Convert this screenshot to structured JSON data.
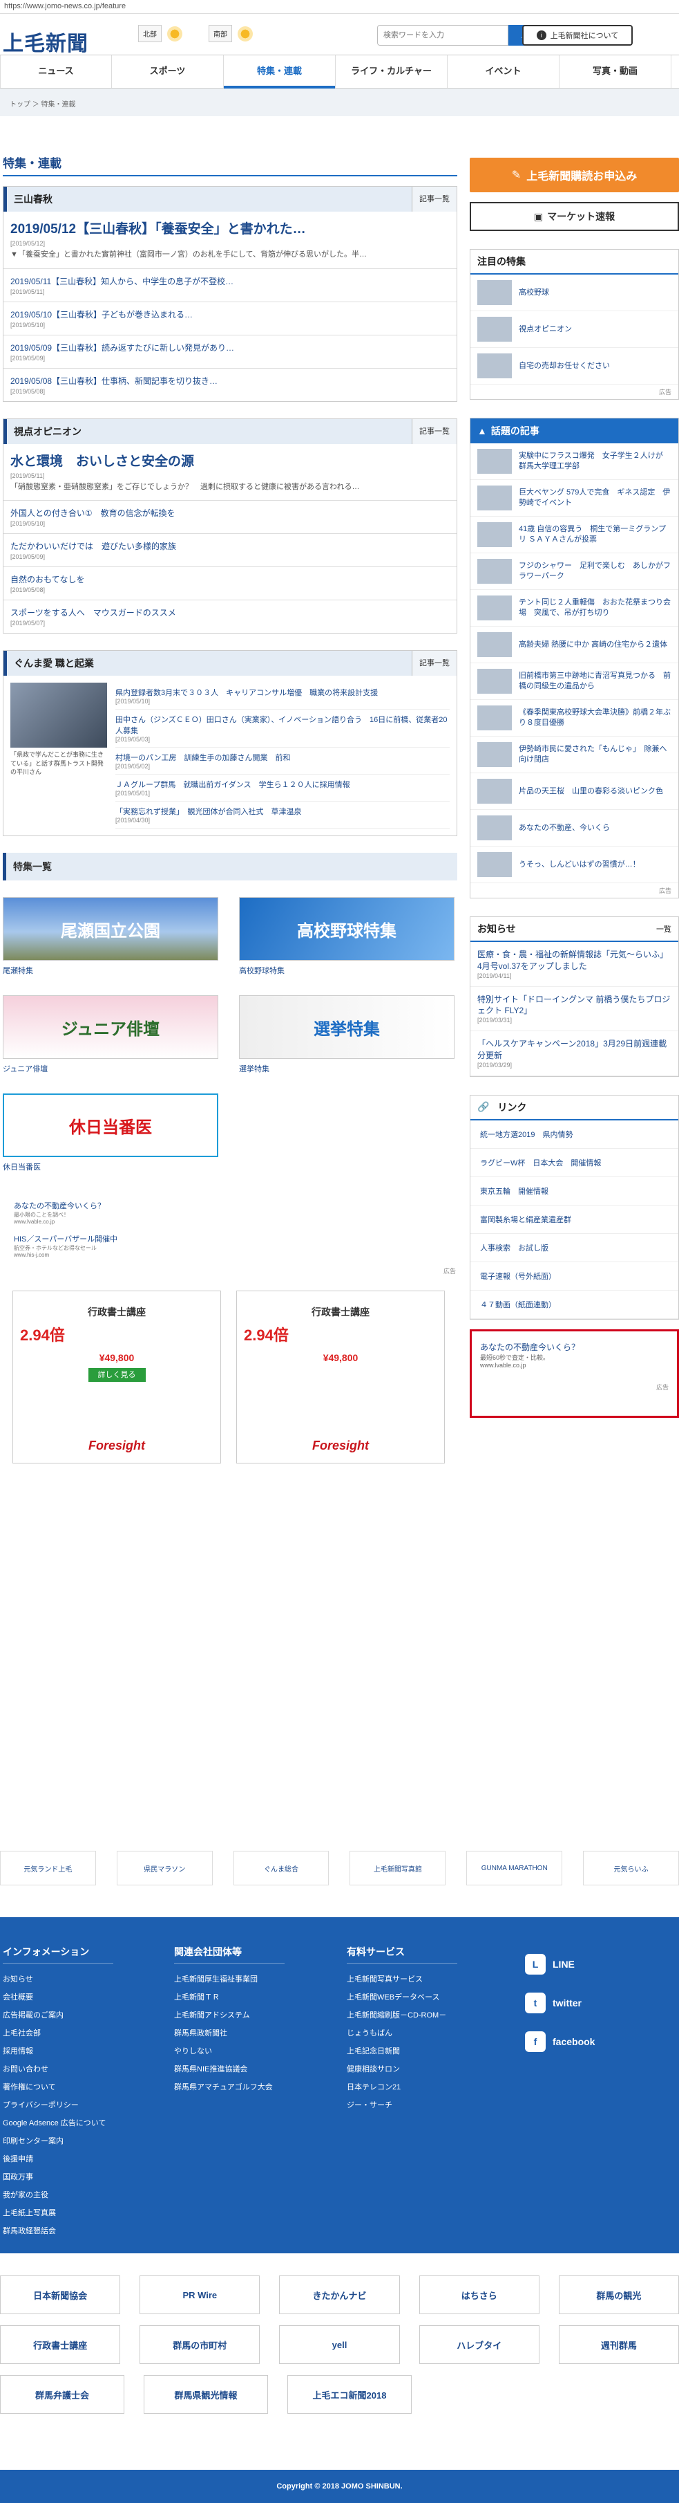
{
  "url": "https://www.jomo-news.co.jp/feature",
  "header": {
    "logo": "上毛新聞",
    "regions": [
      "北部",
      "南部"
    ],
    "search_placeholder": "検索ワードを入力",
    "search_label": "検索",
    "company_label": "上毛新聞社について"
  },
  "nav": [
    "ニュース",
    "スポーツ",
    "特集・連載",
    "ライフ・カルチャー",
    "イベント",
    "写真・動画"
  ],
  "breadcrumb": "トップ ＞ 特集・連載",
  "page_title": "特集・連載",
  "sanzan": {
    "head": "三山春秋",
    "more": "記事一覧",
    "lead_title": "2019/05/12【三山春秋】「養蚕安全」と書かれた…",
    "lead_date": "[2019/05/12]",
    "lead_text": "▼「養蚕安全」と書かれた實前神社（富岡市一ノ宮）のお札を手にして、背筋が伸びる思いがした。半…",
    "items": [
      {
        "t": "2019/05/11【三山春秋】知人から、中学生の息子が不登校…",
        "d": "[2019/05/11]"
      },
      {
        "t": "2019/05/10【三山春秋】子どもが巻き込まれる…",
        "d": "[2019/05/10]"
      },
      {
        "t": "2019/05/09【三山春秋】読み返すたびに新しい発見があり…",
        "d": "[2019/05/09]"
      },
      {
        "t": "2019/05/08【三山春秋】仕事柄、新聞記事を切り抜き…",
        "d": "[2019/05/08]"
      }
    ]
  },
  "opinion": {
    "head": "視点オピニオン",
    "more": "記事一覧",
    "lead_title": "水と環境　おいしさと安全の源",
    "lead_date": "[2019/05/11]",
    "lead_text": "「硝酸態窒素・亜硝酸態窒素」をご存じでしょうか？　過剰に摂取すると健康に被害がある言われる…",
    "items": [
      {
        "t": "外国人との付き合い①　教育の信念が転換を",
        "d": "[2019/05/10]"
      },
      {
        "t": "ただかわいいだけでは　遊びたい多様的家族",
        "d": "[2019/05/09]"
      },
      {
        "t": "自然のおもてなしを",
        "d": "[2019/05/08]"
      },
      {
        "t": "スポーツをする人へ　マウスガードのススメ",
        "d": "[2019/05/07]"
      }
    ]
  },
  "gunma": {
    "head": "ぐんま愛 職と起業",
    "more": "記事一覧",
    "caption": "「県政で学んだことが事務に生きている」と話す群馬トラスト開発の平川さん",
    "items": [
      {
        "t": "県内登録者数3月末で３０３人　キャリアコンサル増優　職業の将来設計支援",
        "d": "[2019/05/10]"
      },
      {
        "t": "田中さん（ジンズＣＥＯ）田口さん（実業家）、イノベーション語り合う　16日に前橋、従業者20人募集",
        "d": "[2019/05/03]"
      },
      {
        "t": "村境一のパン工房　訓練生手の加藤さん開業　前和",
        "d": "[2019/05/02]"
      },
      {
        "t": "ＪＡグループ群馬　就職出前ガイダンス　学生ら１２０人に採用情報",
        "d": "[2019/05/01]"
      },
      {
        "t": "「実務忘れず授業」　観光団体が合同入社式　草津温泉",
        "d": "[2019/04/30]"
      }
    ]
  },
  "tokushu": {
    "head": "特集一覧",
    "items": [
      {
        "img": "尾瀬国立公園",
        "label": "尾瀬特集"
      },
      {
        "img": "高校野球特集",
        "label": "高校野球特集"
      },
      {
        "img": "ジュニア俳壇",
        "label": "ジュニア俳壇"
      },
      {
        "img": "選挙特集",
        "label": "選挙特集"
      },
      {
        "img": "休日当番医",
        "label": "休日当番医"
      }
    ]
  },
  "ad_text": [
    {
      "t": "あなたの不動産今いくら？",
      "s": "最小限のことを調べ！",
      "u": "www.lvable.co.jp"
    },
    {
      "t": "HIS／スーパーバザール開催中",
      "s": "航空券・ホテルなどお得なセール",
      "u": "www.his-j.com"
    }
  ],
  "ad_label": "広告",
  "ad_cards": [
    {
      "ttl": "行政書士講座",
      "pct": "2.94倍",
      "price": "¥49,800",
      "brand": "Foresight",
      "cta": "詳しく見る"
    },
    {
      "ttl": "行政書士講座",
      "pct": "2.94倍",
      "price": "¥49,800",
      "brand": "Foresight",
      "cta": ""
    }
  ],
  "side": {
    "subscribe": "上毛新聞購読お申込み",
    "market": "マーケット速報",
    "featured_head": "注目の特集",
    "featured": [
      "高校野球",
      "視点オピニオン",
      "自宅の売却お任せください"
    ],
    "hot_head": "話題の記事",
    "hot": [
      {
        "t": "実験中にフラスコ爆発　女子学生２人けが　群馬大学理工学部",
        "d": ""
      },
      {
        "t": "巨大ベヤング 579人で完食　ギネス認定　伊勢崎でイベント",
        "d": ""
      },
      {
        "t": "41歳 自信の容異う　桐生で第一ミグランプリ ＳＡＹＡさんが投票",
        "d": ""
      },
      {
        "t": "フジのシャワー　足利で楽しむ　あしかがフラワーパーク",
        "d": ""
      },
      {
        "t": "テント同じ２人重軽傷　おおた花祭まつり会場　突風で、吊が打ち切り",
        "d": ""
      },
      {
        "t": "高齢夫婦 熱腰に中か 高崎の住宅から２遺体",
        "d": ""
      },
      {
        "t": "旧前橋市第三中跡地に青沼写真見つかる　前橋の同級生の遺品から",
        "d": ""
      },
      {
        "t": "《春季関東高校野球大会準決勝》前橋２年ぶり８度目優勝",
        "d": ""
      },
      {
        "t": "伊勢崎市民に愛された「もんじゃ」　除兼へ向け閉店",
        "d": ""
      },
      {
        "t": "片品の天王桜　山里の春彩る淡いピンク色",
        "d": ""
      },
      {
        "t": "あなたの不動産、今いくら",
        "d": ""
      },
      {
        "t": "うそっ、しんどいはずの習慣が…！",
        "d": ""
      }
    ],
    "notice_head": "お知らせ",
    "notice_more": "一覧",
    "notices": [
      {
        "t": "医療・食・農・福祉の新鮮情報誌「元気～らいふ」4月号vol.37をアップしました",
        "d": "[2019/04/11]"
      },
      {
        "t": "特別サイト「ドローイングンマ 前橋う僕たちプロジェクト FLY2」",
        "d": "[2019/03/31]"
      },
      {
        "t": "「ヘルスケアキャンペーン2018」3月29日前週連載分更新",
        "d": "[2019/03/29]"
      }
    ],
    "link_head": "リンク",
    "links": [
      "統一地方選2019　県内情勢",
      "ラグビーW杯　日本大会　開催情報",
      "東京五輪　開催情報",
      "富岡製糸場と絹産業遺産群",
      "人事検索　お試し版",
      "電子速報（号外紙面）",
      "４７動画（紙面連動）"
    ],
    "red_ad_t": "あなたの不動産今いくら？",
    "red_ad_s": "最短60秒で査定・比較。",
    "red_ad_u": "www.lvable.co.jp",
    "ad_label": "広告"
  },
  "strip": [
    "元気ランド上毛",
    "県民マラソン",
    "ぐんま総合",
    "上毛新聞写真館",
    "GUNMA MARATHON",
    "元気らいふ"
  ],
  "footer": {
    "cols": [
      {
        "h": "インフォメーション",
        "items": [
          "お知らせ",
          "会社概要",
          "広告掲載のご案内",
          "上毛社会部",
          "採用情報",
          "お問い合わせ",
          "著作権について",
          "プライバシーポリシー",
          "Google Adsence 広告について",
          "印刷センター案内",
          "後援申請",
          "国政万事",
          "我が家の主役",
          "上毛紙上写真展",
          "群馬政経懇話会"
        ]
      },
      {
        "h": "関連会社団体等",
        "items": [
          "上毛新聞厚生福祉事業団",
          "上毛新聞ＴＲ",
          "上毛新聞アドシステム",
          "群馬県政新聞社",
          "やりしない",
          "群馬県NIE推進協議会",
          "群馬県アマチュアゴルフ大会"
        ]
      },
      {
        "h": "有料サービス",
        "items": [
          "上毛新聞写真サービス",
          "上毛新聞WEBデータベース",
          "上毛新聞縮刷版－CD-ROM－",
          "じょうもばん",
          "上毛記念日新聞",
          "健康相談サロン",
          "日本テレコン21",
          "ジー・サーチ"
        ]
      }
    ],
    "social": [
      "LINE",
      "twitter",
      "facebook"
    ]
  },
  "partners": [
    [
      "日本新聞協会",
      "PR Wire",
      "きたかんナビ",
      "はちさら",
      "群馬の観光"
    ],
    [
      "行政書士講座",
      "群馬の市町村",
      "yell",
      "ハレブタイ",
      "週刊群馬"
    ],
    [
      "群馬弁護士会",
      "群馬県観光情報",
      "上毛エコ新聞2018"
    ]
  ],
  "copyright": "Copyright © 2018 JOMO SHINBUN."
}
